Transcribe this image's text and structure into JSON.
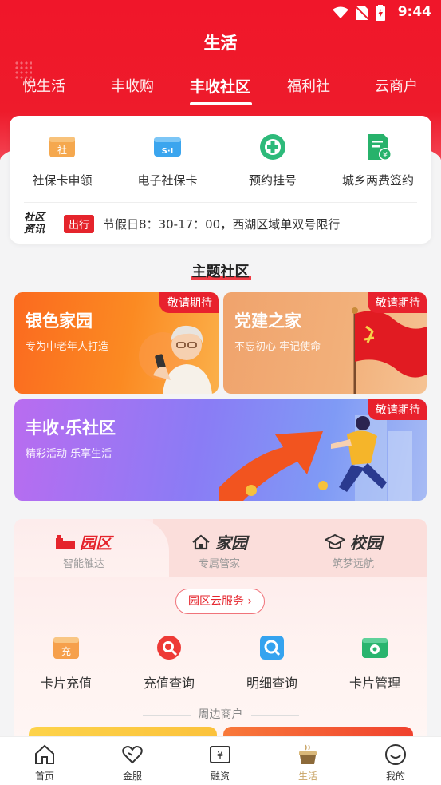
{
  "status_bar": {
    "time": "9:44"
  },
  "header": {
    "title": "生活"
  },
  "tabs": [
    {
      "label": "悦生活"
    },
    {
      "label": "丰收购"
    },
    {
      "label": "丰收社区",
      "active": true
    },
    {
      "label": "福利社"
    },
    {
      "label": "云商户"
    }
  ],
  "services": [
    {
      "label": "社保卡申领",
      "icon": "social-card-icon",
      "glyph": "社"
    },
    {
      "label": "电子社保卡",
      "icon": "e-card-icon",
      "glyph": "S·I"
    },
    {
      "label": "预约挂号",
      "icon": "medical-plus-icon"
    },
    {
      "label": "城乡两费签约",
      "icon": "document-yuan-icon"
    }
  ],
  "news": {
    "logo": "社区资讯",
    "tag": "出行",
    "text": "节假日8：30-17：00，西湖区域单双号限行"
  },
  "section_title": "主题社区",
  "features": [
    {
      "title": "银色家园",
      "subtitle": "专为中老年人打造",
      "badge": "敬请期待"
    },
    {
      "title": "党建之家",
      "subtitle": "不忘初心 牢记使命",
      "badge": "敬请期待"
    },
    {
      "title": "丰收·乐社区",
      "subtitle": "精彩活动 乐享生活",
      "badge": "敬请期待"
    }
  ],
  "campus": {
    "tabs": [
      {
        "title": "园区",
        "subtitle": "智能触达",
        "active": true
      },
      {
        "title": "家园",
        "subtitle": "专属管家"
      },
      {
        "title": "校园",
        "subtitle": "筑梦远航"
      }
    ],
    "cloud_button": "园区云服务",
    "functions": [
      {
        "label": "卡片充值",
        "glyph": "充"
      },
      {
        "label": "充值查询"
      },
      {
        "label": "明细查询"
      },
      {
        "label": "卡片管理"
      }
    ],
    "nearby_label": "周边商户"
  },
  "tabbar": [
    {
      "label": "首页",
      "icon": "home-icon"
    },
    {
      "label": "金服",
      "icon": "heart-icon"
    },
    {
      "label": "融资",
      "icon": "yuan-icon",
      "glyph": "¥"
    },
    {
      "label": "生活",
      "icon": "life-cup-icon",
      "active": true
    },
    {
      "label": "我的",
      "icon": "smile-icon"
    }
  ],
  "colors": {
    "brand_red": "#ee1b2b",
    "active_tab_gold": "#c9a567"
  }
}
